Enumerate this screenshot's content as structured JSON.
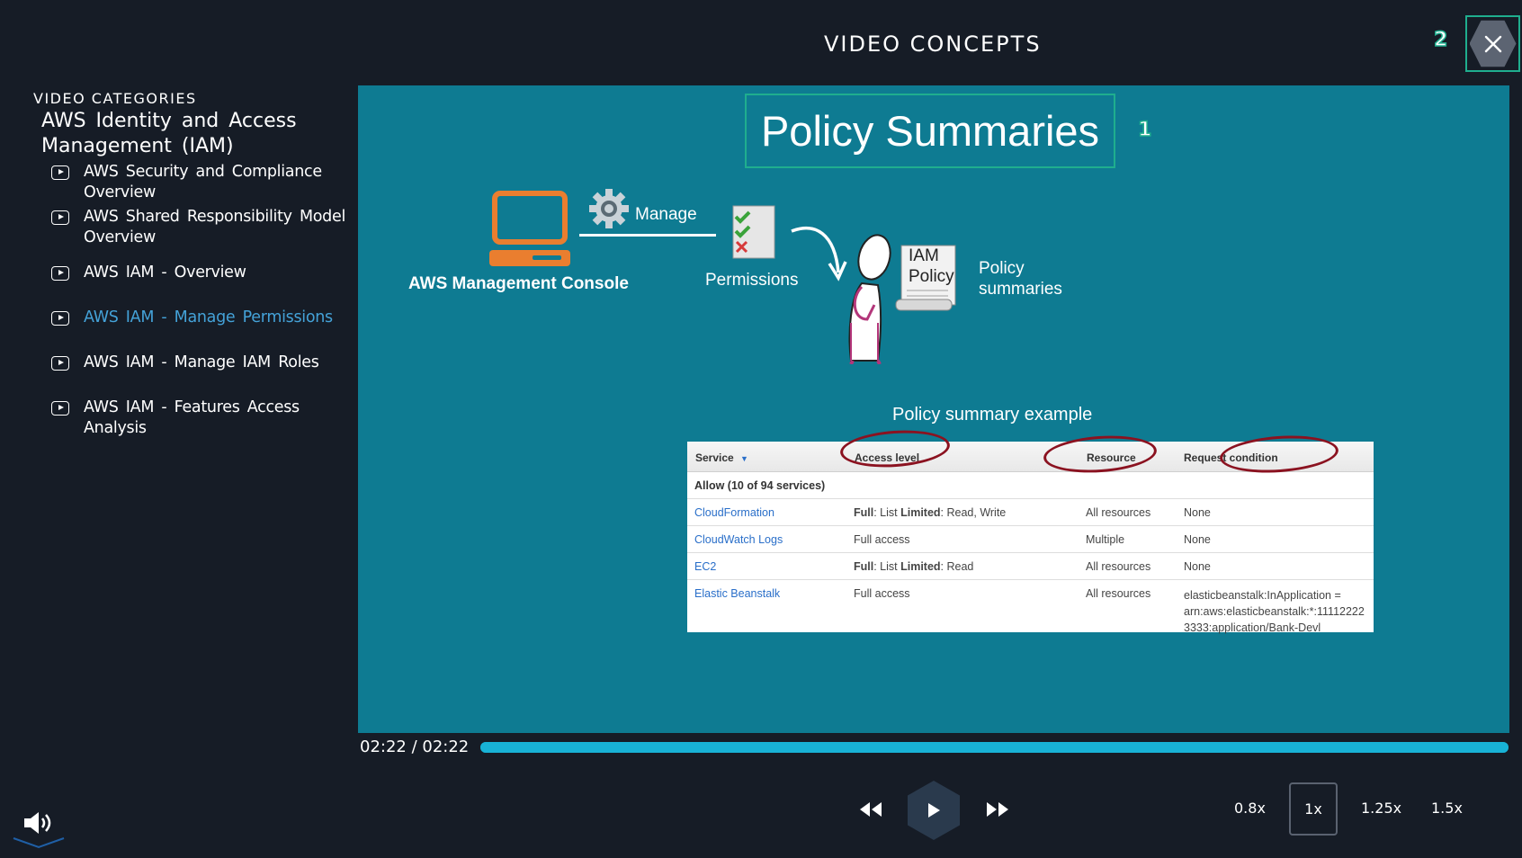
{
  "header": {
    "title": "VIDEO CONCEPTS",
    "badge_close": "2"
  },
  "sidebar": {
    "label": "VIDEO CATEGORIES",
    "heading": "AWS Identity and Access Management (IAM)",
    "items": [
      {
        "label": "AWS Security and Compliance Overview"
      },
      {
        "label": "AWS Shared Responsibility Model Overview"
      },
      {
        "label": "AWS IAM - Overview"
      },
      {
        "label": "AWS IAM - Manage Permissions",
        "active": true
      },
      {
        "label": "AWS IAM - Manage IAM Roles"
      },
      {
        "label": "AWS IAM - Features Access Analysis"
      }
    ]
  },
  "slide": {
    "title": "Policy Summaries",
    "badge_title": "1",
    "console_label": "AWS Management Console",
    "manage_label": "Manage",
    "permissions_label": "Permissions",
    "iam_doc_line1": "IAM",
    "iam_doc_line2": "Policy",
    "policy_summaries_line1": "Policy",
    "policy_summaries_line2": "summaries",
    "example_label": "Policy summary example",
    "table": {
      "headers": [
        "Service",
        "Access level",
        "Resource",
        "Request condition"
      ],
      "allow_row": "Allow (10 of 94 services)",
      "rows": [
        {
          "service": "CloudFormation",
          "access_bold1": "Full",
          "access_mid": ": List ",
          "access_bold2": "Limited",
          "access_rest": ": Read, Write",
          "resource": "All resources",
          "condition": "None"
        },
        {
          "service": "CloudWatch Logs",
          "access_plain": "Full access",
          "resource": "Multiple",
          "condition": "None"
        },
        {
          "service": "EC2",
          "access_bold1": "Full",
          "access_mid": ": List ",
          "access_bold2": "Limited",
          "access_rest": ": Read",
          "resource": "All resources",
          "condition": "None"
        },
        {
          "service": "Elastic Beanstalk",
          "access_plain": "Full access",
          "resource": "All resources",
          "condition_lines": [
            "elasticbeanstalk:InApplication =",
            "arn:aws:elasticbeanstalk:*:11112222",
            "3333:application/Bank-Devl"
          ]
        }
      ]
    }
  },
  "player": {
    "time": "02:22 / 02:22",
    "progress": 1.0,
    "speeds": [
      "0.8x",
      "1x",
      "1.25x",
      "1.5x"
    ],
    "active_speed": "1x"
  },
  "colors": {
    "accent": "#1fae8e",
    "active_link": "#44a2d8",
    "video_bg": "#0e7b92",
    "progress": "#18b2d6",
    "oval": "#8b1220"
  }
}
